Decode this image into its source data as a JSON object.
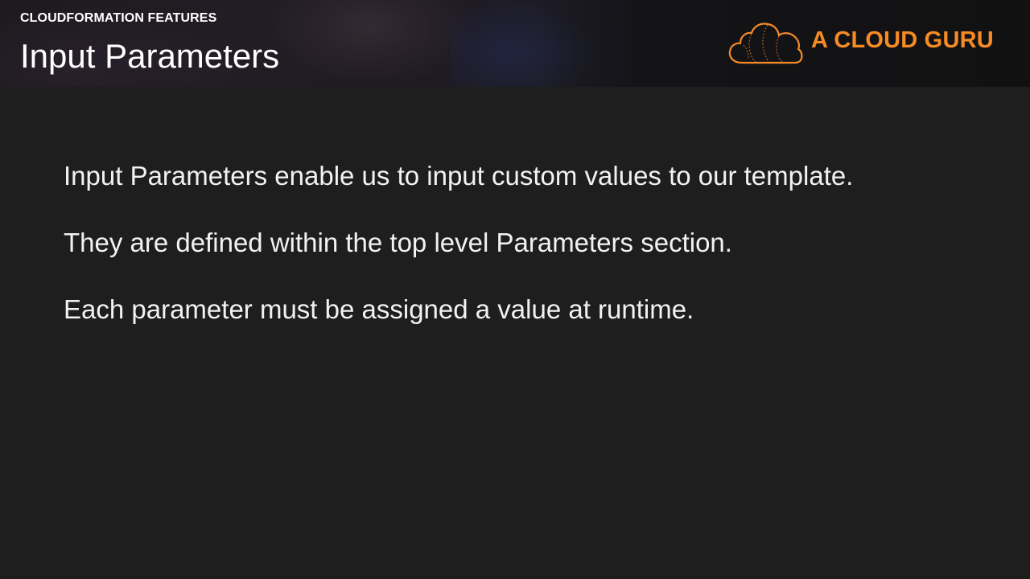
{
  "header": {
    "kicker": "CLOUDFORMATION FEATURES",
    "title": "Input Parameters",
    "logo": {
      "text": "A CLOUD GURU",
      "icon": "cloud-icon",
      "color": "#f68b25"
    }
  },
  "body": {
    "lines": [
      "Input Parameters enable us to input custom values to our template.",
      "They are defined within the top level Parameters section.",
      "Each parameter must be assigned a value at runtime."
    ]
  },
  "colors": {
    "background": "#1e1e1e",
    "text": "#f2f2f2",
    "accent": "#f68b25"
  }
}
